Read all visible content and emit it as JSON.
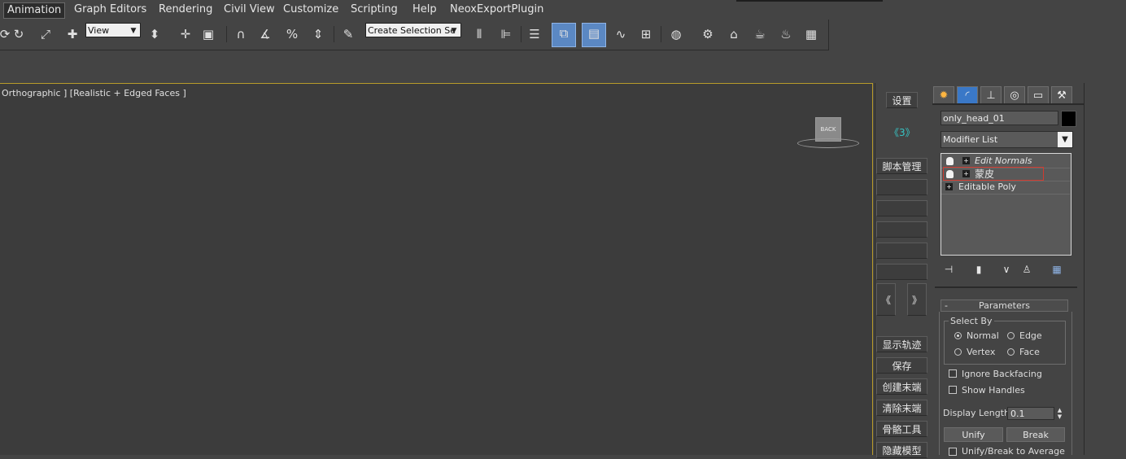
{
  "menu": {
    "items": [
      "Animation",
      "Graph Editors",
      "Rendering",
      "Civil View",
      "Customize",
      "Scripting",
      "Help",
      "NeoxExportPlugin"
    ]
  },
  "toolbar": {
    "view_combo": "View",
    "selection_set_combo": "Create Selection Se"
  },
  "viewport": {
    "label": "Orthographic ] [Realistic + Edged Faces ]",
    "viewcube_face": "BACK"
  },
  "script_panel": {
    "settings": "设置",
    "page_indicator": "《3》",
    "script_manager": "脚本管理",
    "prev": "《",
    "next": "》",
    "buttons": [
      "显示轨迹",
      "保存",
      "创建末端",
      "清除末端",
      "骨骼工具",
      "隐藏模型"
    ]
  },
  "command_panel": {
    "object_name": "only_head_01",
    "modifier_list": "Modifier List",
    "stack": [
      {
        "label": "Edit Normals"
      },
      {
        "label": "蒙皮"
      },
      {
        "label": "Editable Poly"
      }
    ],
    "rollout": {
      "title": "Parameters",
      "collapse": "-",
      "select_by": {
        "title": "Select By",
        "options": [
          "Normal",
          "Edge",
          "Vertex",
          "Face"
        ],
        "selected": "Normal"
      },
      "ignore_backfacing": "Ignore Backfacing",
      "show_handles": "Show Handles",
      "display_length_label": "Display Length:",
      "display_length_value": "0.1",
      "unify": "Unify",
      "break": "Break",
      "unify_break_avg": "Unify/Break to Average"
    }
  },
  "colors": {
    "background": "#444444",
    "viewport": "#3c3c3c",
    "viewport_border": "#b89b2a",
    "highlight": "#5b88c3",
    "selection_outline": "#d03a2f"
  }
}
